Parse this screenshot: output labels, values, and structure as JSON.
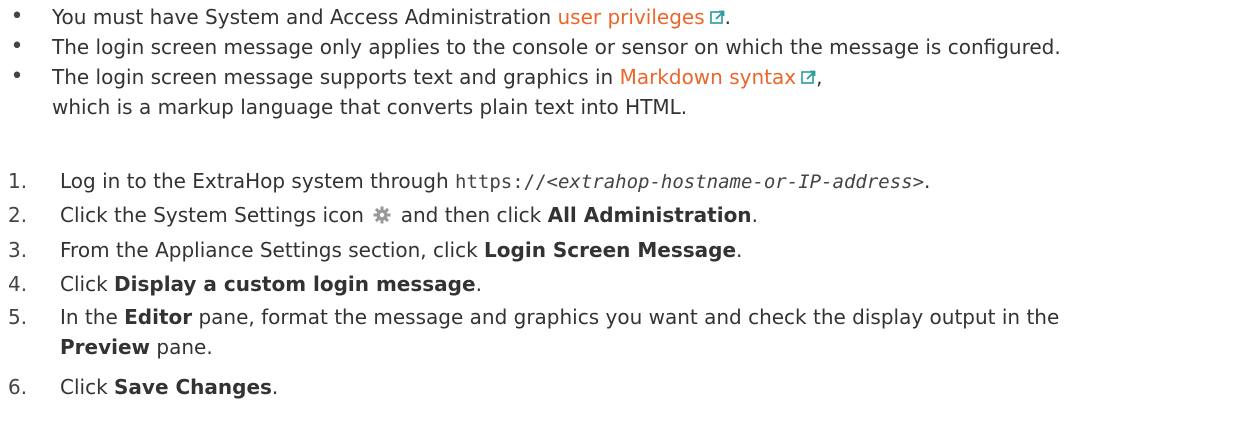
{
  "prerequisites": {
    "item1": {
      "before": "You must have System and Access Administration ",
      "link": "user privileges",
      "after": "."
    },
    "item2": {
      "text": "The login screen message only applies to the console or sensor on which the message is configured."
    },
    "item3": {
      "before": "The login screen message supports text and graphics in ",
      "link": "Markdown syntax",
      "after": ", which is a markup language that converts plain text into HTML."
    }
  },
  "steps": [
    {
      "number": "1."
    },
    {
      "number": "2."
    },
    {
      "number": "3."
    },
    {
      "number": "4."
    },
    {
      "number": "5."
    },
    {
      "number": "6."
    }
  ],
  "step1": {
    "before": "Log in to the ExtraHop system through ",
    "code_prefix": "https://",
    "code_var": "<extrahop-hostname-or-IP-address>",
    "after": "."
  },
  "step2": {
    "before": "Click the System Settings icon",
    "middle": "and then click ",
    "bold": "All Administration",
    "after": "."
  },
  "step3": {
    "before": "From the Appliance Settings section, click ",
    "bold": "Login Screen Message",
    "after": "."
  },
  "step4": {
    "before": "Click ",
    "bold": "Display a custom login message",
    "after": "."
  },
  "step5": {
    "before": "In the ",
    "bold1": "Editor",
    "middle": " pane, format the message and graphics you want and check the display output in the ",
    "bold2": "Preview",
    "after": " pane."
  },
  "step6": {
    "before": "Click ",
    "bold": "Save Changes",
    "after": "."
  },
  "icons": {
    "external_link": "external-link-icon",
    "settings": "gear-icon"
  },
  "colors": {
    "link": "#ec6629",
    "external_icon": "#2a9d9b",
    "gear": "#999999",
    "text": "#333333"
  }
}
